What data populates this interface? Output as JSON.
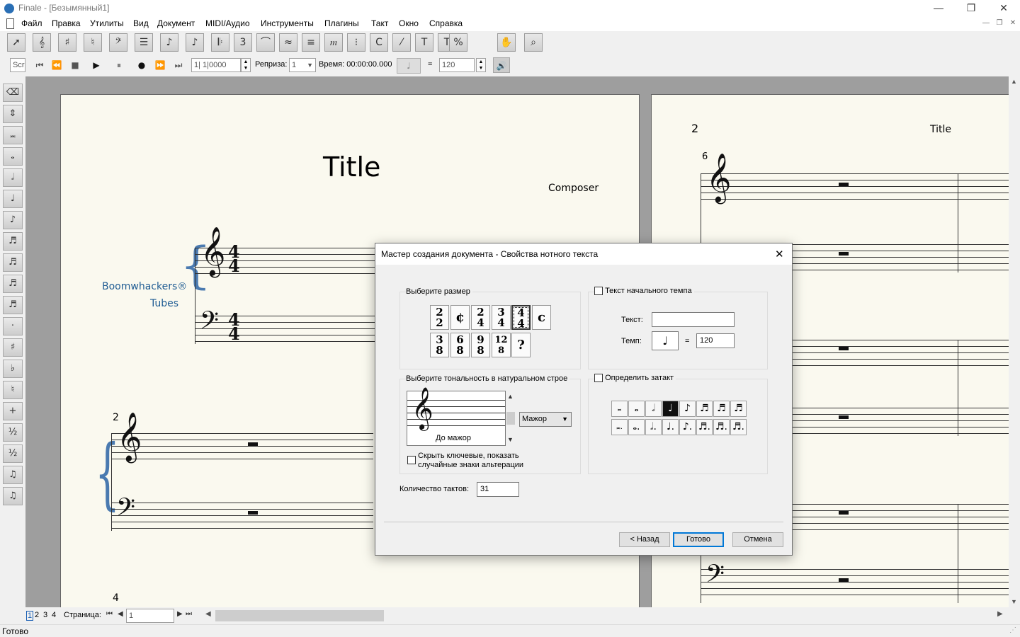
{
  "window": {
    "title": "Finale - [Безымянный1]",
    "controls": {
      "minimize": "—",
      "restore": "❐",
      "close": "✕"
    }
  },
  "menu": {
    "items": [
      "Файл",
      "Правка",
      "Утилиты",
      "Вид",
      "Документ",
      "MIDI/Аудио",
      "Инструменты",
      "Плагины",
      "Такт",
      "Окно",
      "Справка"
    ]
  },
  "playback": {
    "scroll_label": "Scr",
    "position": "1| 1|0000",
    "repeat_label": "Реприза:",
    "repeat_value": "1",
    "time_label": "Время: 00:00:00.000",
    "equals": "=",
    "tempo_value": "120"
  },
  "score": {
    "page1": {
      "title": "Title",
      "composer": "Composer",
      "instrument_line1": "Boomwhackers®",
      "instrument_line2": "Tubes",
      "time_sig_top": "4",
      "time_sig_bottom": "4",
      "measure_number_2": "2",
      "measure_number_4": "4"
    },
    "page2": {
      "page_number": "2",
      "header_title": "Title",
      "measure_number": "6"
    }
  },
  "dialog": {
    "title": "Мастер создания документа - Свойства нотного текста",
    "time_sig_group": "Выберите размер",
    "time_signatures_row1": [
      {
        "top": "2",
        "bottom": "2"
      },
      {
        "symbol": "¢"
      },
      {
        "top": "2",
        "bottom": "4"
      },
      {
        "top": "3",
        "bottom": "4"
      },
      {
        "top": "4",
        "bottom": "4"
      },
      {
        "symbol": "c"
      }
    ],
    "time_signatures_row2": [
      {
        "top": "3",
        "bottom": "8"
      },
      {
        "top": "6",
        "bottom": "8"
      },
      {
        "top": "9",
        "bottom": "8"
      },
      {
        "top": "12",
        "bottom": "8"
      },
      {
        "symbol": "?"
      }
    ],
    "selected_time_sig": "4/4",
    "tempo_group": "Текст начального темпа",
    "tempo_text_label": "Текст:",
    "tempo_text_value": "",
    "tempo_label": "Темп:",
    "tempo_equals": "=",
    "tempo_value": "120",
    "key_group": "Выберите тональность в натуральном строе",
    "key_name": "До мажор",
    "mode_value": "Мажор",
    "hide_key_label_line1": "Скрыть ключевые, показать",
    "hide_key_label_line2": "случайные знаки альтерации",
    "pickup_group": "Определить затакт",
    "measures_label": "Количество тактов:",
    "measures_value": "31",
    "buttons": {
      "back": "< Назад",
      "finish": "Готово",
      "cancel": "Отмена"
    }
  },
  "page_nav": {
    "pages": [
      "1",
      "2",
      "3",
      "4"
    ],
    "page_label": "Страница:",
    "page_value": "1"
  },
  "status": {
    "text": "Готово"
  }
}
